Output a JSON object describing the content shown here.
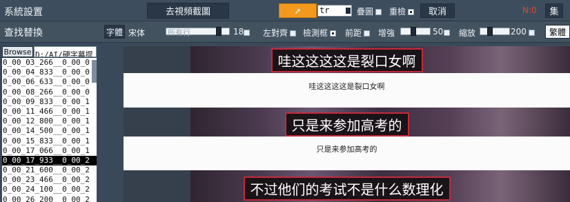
{
  "toolbar1": {
    "system_settings": "系統設置",
    "remove_frames": "去視頻截圖",
    "mode_value": "tr",
    "overlap_label": "疊圖",
    "recheck_label": "重檢",
    "cancel_label": "取消",
    "n_label": "N:0",
    "set_label": "集"
  },
  "toolbar2": {
    "find_replace": "查找替換",
    "font_label": "字體",
    "font_value": "宋体",
    "all_rows": "所有行",
    "size_value": "18",
    "align_left": "左對齊",
    "detect_box": "檢測框",
    "spacing": "前距",
    "enhance": "增強",
    "enhance_value": "50",
    "zoom": "縮放",
    "zoom_value": "200",
    "traditional": "繁體"
  },
  "browse": {
    "button": "Browse",
    "path": "D:/AI/硬字幕提",
    "items": [
      "0_00_03_266__0_00_0",
      "0_00_04_833__0_00_0",
      "0_00_06_633__0_00_0",
      "0_00_08_266__0_00_0",
      "0_00_09_833__0_00_1",
      "0_00_11_466__0_00_1",
      "0_00_12_800__0_00_1",
      "0_00_14_500__0_00_1",
      "0_00_15_833__0_00_1",
      "0_00_17_066__0_00_1",
      "0_00_17_933__0_00_2",
      "0_00_21_600__0_00_2",
      "0_00_23_466__0_00_2",
      "0_00_24_100__0_00_2",
      "0_00_26_200__0_00_2"
    ],
    "selected_index": 10
  },
  "subtitles": {
    "frame1": "哇这这这这是裂口女啊",
    "text1": "哇这这这这是裂口女啊",
    "frame2": "只是来参加高考的",
    "text2": "只是来参加高考的",
    "frame3": "不过他们的考试不是什么数理化"
  },
  "colors": {
    "accent_orange": "#f39a1e",
    "subtitle_border": "#c52a3a",
    "selection": "#000000"
  }
}
